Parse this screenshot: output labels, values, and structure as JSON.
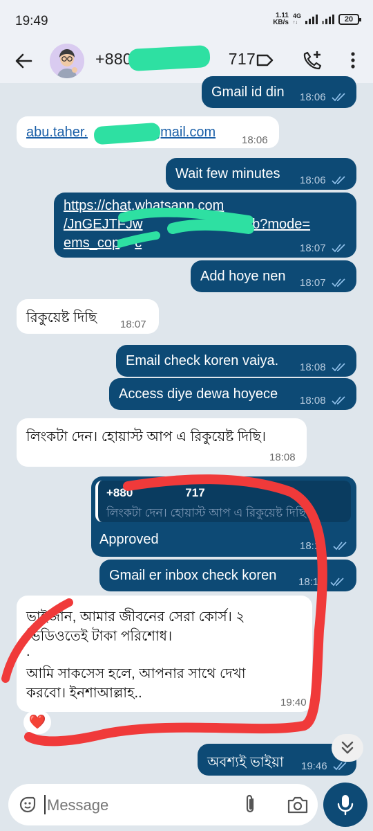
{
  "status_bar": {
    "time": "19:49",
    "net_speed_value": "1.11",
    "net_speed_unit": "KB/s",
    "network": "4G",
    "battery": "20"
  },
  "header": {
    "contact_prefix": "+880 1",
    "contact_suffix": "717",
    "icons": [
      "back-arrow-icon",
      "label-icon",
      "add-call-icon",
      "more-vert-icon"
    ]
  },
  "messages": [
    {
      "dir": "out",
      "text": "Gmail id din",
      "time": "18:06"
    },
    {
      "dir": "in",
      "text_prefix": "abu.taher.",
      "text_suffix": "gmail.com",
      "time": "18:06"
    },
    {
      "dir": "out",
      "text": "Wait few minutes",
      "time": "18:06"
    },
    {
      "dir": "out",
      "line1": "https://chat.whatsapp.com",
      "line2": "/JnGEJTFJw",
      "line2_end": "osQzb?mode=",
      "line3": "ems_cop",
      "line3_end": "c",
      "time": "18:07"
    },
    {
      "dir": "out",
      "text": "Add hoye nen",
      "time": "18:07"
    },
    {
      "dir": "in",
      "text": "রিকুয়েষ্ট দিছি",
      "time": "18:07"
    },
    {
      "dir": "out",
      "text": "Email check koren vaiya.",
      "time": "18:08"
    },
    {
      "dir": "out",
      "text": "Access diye dewa hoyece",
      "time": "18:08"
    },
    {
      "dir": "in",
      "text": "লিংকটা দেন। হোয়াস্ট আপ এ রিকুয়েষ্ট দিছি।",
      "time": "18:08"
    },
    {
      "dir": "out",
      "quote_sender_prefix": "+880",
      "quote_sender_suffix": "717",
      "quote_text": "লিংকটা দেন। হোয়াস্ট আপ এ রিকুয়েষ্ট দিছি।",
      "text": "Approved",
      "time": "18:10"
    },
    {
      "dir": "out",
      "text": "Gmail er inbox check koren",
      "time": "18:10"
    },
    {
      "dir": "in",
      "line1": "ভাইজান, আমার জীবনের সেরা কোর্স। ২",
      "line2": "ভিডিওতেই টাকা পরিশোধ।",
      "line3": ".",
      "line4": "আমি সাকসেস হলে, আপনার সাথে দেখা",
      "line5": "করবো। ইনশাআল্লাহ..",
      "time": "19:40",
      "reaction": "❤️"
    },
    {
      "dir": "out",
      "text": "অবশ্যই ভাইয়া",
      "time": "19:46"
    }
  ],
  "composer": {
    "placeholder": "Message",
    "icons": [
      "sticker-icon",
      "attach-icon",
      "camera-icon",
      "mic-icon"
    ]
  },
  "colors": {
    "outgoing_bubble": "#0d4a75",
    "incoming_bubble": "#ffffff",
    "redaction_marker": "#2ee0a2",
    "annotation_red": "#f03a3a"
  }
}
